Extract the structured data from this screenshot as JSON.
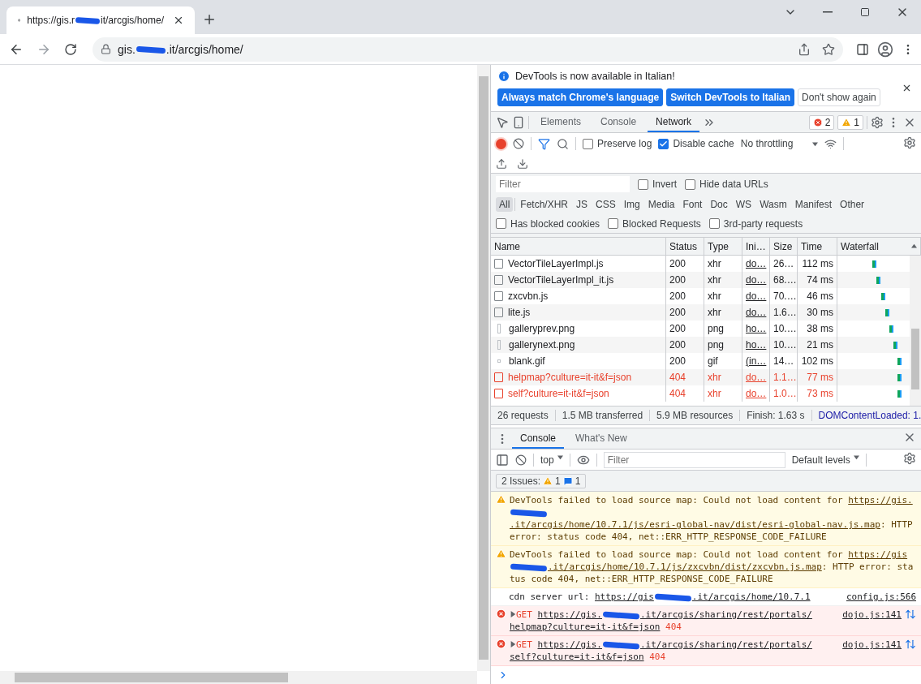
{
  "browser": {
    "tab": {
      "title_before": "https://gis.r",
      "title_after": "it/arcgis/home/"
    },
    "address": {
      "before": "gis.",
      "after": ".it/arcgis/home/"
    }
  },
  "infobar": {
    "message": "DevTools is now available in Italian!",
    "buttons": [
      {
        "label": "Always match Chrome's language",
        "kind": "primary"
      },
      {
        "label": "Switch DevTools to Italian",
        "kind": "primary"
      },
      {
        "label": "Don't show again",
        "kind": "secondary"
      }
    ]
  },
  "panel_tabs": [
    {
      "label": "Elements",
      "selected": false
    },
    {
      "label": "Console",
      "selected": false
    },
    {
      "label": "Network",
      "selected": true
    }
  ],
  "error_count": "2",
  "warning_count": "1",
  "network_toolbar": {
    "checkboxes": [
      {
        "label": "Preserve log",
        "checked": false
      },
      {
        "label": "Disable cache",
        "checked": true
      }
    ],
    "throttling": "No throttling"
  },
  "filter": {
    "placeholder": "Filter",
    "checkboxes": [
      {
        "label": "Invert",
        "checked": false
      },
      {
        "label": "Hide data URLs",
        "checked": false
      }
    ]
  },
  "type_filters": [
    {
      "label": "All",
      "selected": true
    },
    {
      "label": "Fetch/XHR",
      "selected": false
    },
    {
      "label": "JS",
      "selected": false
    },
    {
      "label": "CSS",
      "selected": false
    },
    {
      "label": "Img",
      "selected": false
    },
    {
      "label": "Media",
      "selected": false
    },
    {
      "label": "Font",
      "selected": false
    },
    {
      "label": "Doc",
      "selected": false
    },
    {
      "label": "WS",
      "selected": false
    },
    {
      "label": "Wasm",
      "selected": false
    },
    {
      "label": "Manifest",
      "selected": false
    },
    {
      "label": "Other",
      "selected": false
    }
  ],
  "blocked_filters": [
    {
      "label": "Has blocked cookies",
      "checked": false
    },
    {
      "label": "Blocked Requests",
      "checked": false
    },
    {
      "label": "3rd-party requests",
      "checked": false
    }
  ],
  "table": {
    "columns": [
      "Name",
      "Status",
      "Type",
      "Ini…",
      "Size",
      "Time",
      "Waterfall"
    ],
    "rows": [
      {
        "name": "VectorTileLayerImpl.js",
        "status": "200",
        "type": "xhr",
        "initiator": "do…",
        "size": "26…",
        "time": "112 ms",
        "error": false,
        "kind": "document"
      },
      {
        "name": "VectorTileLayerImpl_it.js",
        "status": "200",
        "type": "xhr",
        "initiator": "do…",
        "size": "68.…",
        "time": "74 ms",
        "error": false,
        "kind": "document"
      },
      {
        "name": "zxcvbn.js",
        "status": "200",
        "type": "xhr",
        "initiator": "do…",
        "size": "70.…",
        "time": "46 ms",
        "error": false,
        "kind": "document"
      },
      {
        "name": "lite.js",
        "status": "200",
        "type": "xhr",
        "initiator": "do…",
        "size": "1.6…",
        "time": "30 ms",
        "error": false,
        "kind": "document"
      },
      {
        "name": "galleryprev.png",
        "status": "200",
        "type": "png",
        "initiator": "ho…",
        "size": "10.…",
        "time": "38 ms",
        "error": false,
        "kind": "image"
      },
      {
        "name": "gallerynext.png",
        "status": "200",
        "type": "png",
        "initiator": "ho…",
        "size": "10.…",
        "time": "21 ms",
        "error": false,
        "kind": "image"
      },
      {
        "name": "blank.gif",
        "status": "200",
        "type": "gif",
        "initiator": "(in…",
        "size": "14…",
        "time": "102 ms",
        "error": false,
        "kind": "dot"
      },
      {
        "name": "helpmap?culture=it-it&f=json",
        "status": "404",
        "type": "xhr",
        "initiator": "do…",
        "size": "1.1…",
        "time": "77 ms",
        "error": true,
        "kind": "document"
      },
      {
        "name": "self?culture=it-it&f=json",
        "status": "404",
        "type": "xhr",
        "initiator": "do…",
        "size": "1.0…",
        "time": "73 ms",
        "error": true,
        "kind": "document"
      }
    ]
  },
  "summary": [
    "26 requests",
    "1.5 MB transferred",
    "5.9 MB resources",
    "Finish: 1.63 s"
  ],
  "dom_content_loaded": "DOMContentLoaded: 1.",
  "drawer_tabs": [
    {
      "label": "Console",
      "selected": true
    },
    {
      "label": "What's New",
      "selected": false
    }
  ],
  "console_toolbar": {
    "context": "top",
    "filter_placeholder": "Filter",
    "levels": "Default levels"
  },
  "issues": {
    "label": "2 Issues:",
    "warnings": "1",
    "infos": "1"
  },
  "messages": [
    {
      "kind": "warning",
      "parts": [
        {
          "kind": "text",
          "text": "DevTools failed to load source map: Could not load content for "
        },
        {
          "kind": "link",
          "text": "https://gis."
        },
        {
          "kind": "redacted"
        },
        {
          "kind": "link",
          "text": ".it/arcgis/home/10.7.1/js/esri-global-nav/dist/esri-global-nav.js.map"
        },
        {
          "kind": "text",
          "text": ": HTTP error: status code 404, net::ERR_HTTP_RESPONSE_CODE_FAILURE"
        }
      ]
    },
    {
      "kind": "warning",
      "parts": [
        {
          "kind": "text",
          "text": "DevTools failed to load source map: Could not load content for "
        },
        {
          "kind": "link",
          "text": "https://gis"
        },
        {
          "kind": "redacted"
        },
        {
          "kind": "link",
          "text": ".it/arcgis/home/10.7.1/js/zxcvbn/dist/zxcvbn.js.map"
        },
        {
          "kind": "text",
          "text": ": HTTP error: status code 404, net::ERR_HTTP_RESPONSE_CODE_FAILURE"
        }
      ]
    },
    {
      "kind": "info",
      "source": "config.js:566",
      "parts": [
        {
          "kind": "text",
          "text": "cdn server url: "
        },
        {
          "kind": "link",
          "text": "https://gis"
        },
        {
          "kind": "redacted"
        },
        {
          "kind": "link",
          "text": ".it/arcgis/home/10.7.1"
        }
      ]
    },
    {
      "kind": "error",
      "source": "dojo.js:141",
      "parts": [
        {
          "kind": "method",
          "text": "GET"
        },
        {
          "kind": "link",
          "text": "https://gis."
        },
        {
          "kind": "redacted"
        },
        {
          "kind": "link",
          "text": ".it/arcgis/sharing/rest/portals/"
        },
        {
          "kind": "link",
          "text": "helpmap?culture=it-it&f=json"
        },
        {
          "kind": "code",
          "text": "404"
        }
      ]
    },
    {
      "kind": "error",
      "source": "dojo.js:141",
      "parts": [
        {
          "kind": "method",
          "text": "GET"
        },
        {
          "kind": "link",
          "text": "https://gis."
        },
        {
          "kind": "redacted"
        },
        {
          "kind": "link",
          "text": ".it/arcgis/sharing/rest/portals/"
        },
        {
          "kind": "link",
          "text": "self?culture=it-it&f=json"
        },
        {
          "kind": "code",
          "text": "404"
        }
      ]
    }
  ]
}
